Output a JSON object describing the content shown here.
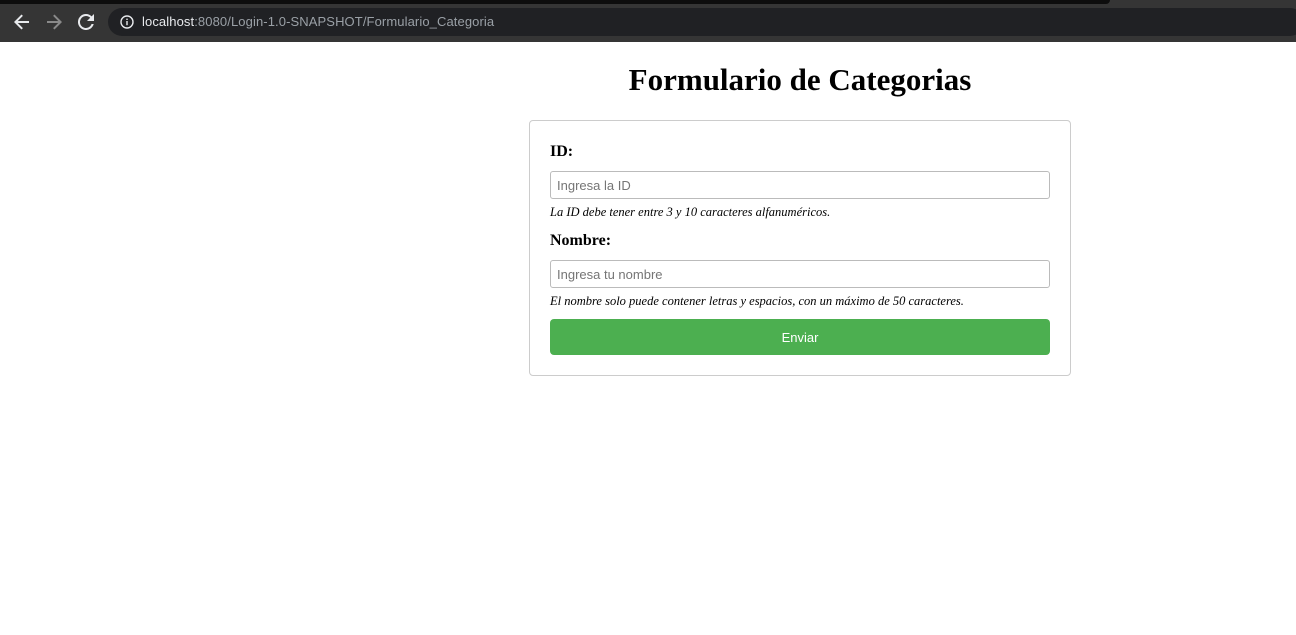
{
  "browser": {
    "url_host": "localhost",
    "url_rest": ":8080/Login-1.0-SNAPSHOT/Formulario_Categoria",
    "icons": [
      "back-arrow-icon",
      "forward-arrow-icon",
      "reload-icon",
      "info-icon"
    ]
  },
  "page": {
    "title": "Formulario de Categorias"
  },
  "form": {
    "id_label": "ID:",
    "id_placeholder": "Ingresa la ID",
    "id_value": "",
    "id_hint": "La ID debe tener entre 3 y 10 caracteres alfanuméricos.",
    "name_label": "Nombre:",
    "name_placeholder": "Ingresa tu nombre",
    "name_value": "",
    "name_hint": "El nombre solo puede contener letras y espacios, con un máximo de 50 caracteres.",
    "submit_label": "Enviar"
  },
  "colors": {
    "submit_button": "#4caf50",
    "browser_toolbar": "#353535",
    "omnibox": "#202124"
  }
}
